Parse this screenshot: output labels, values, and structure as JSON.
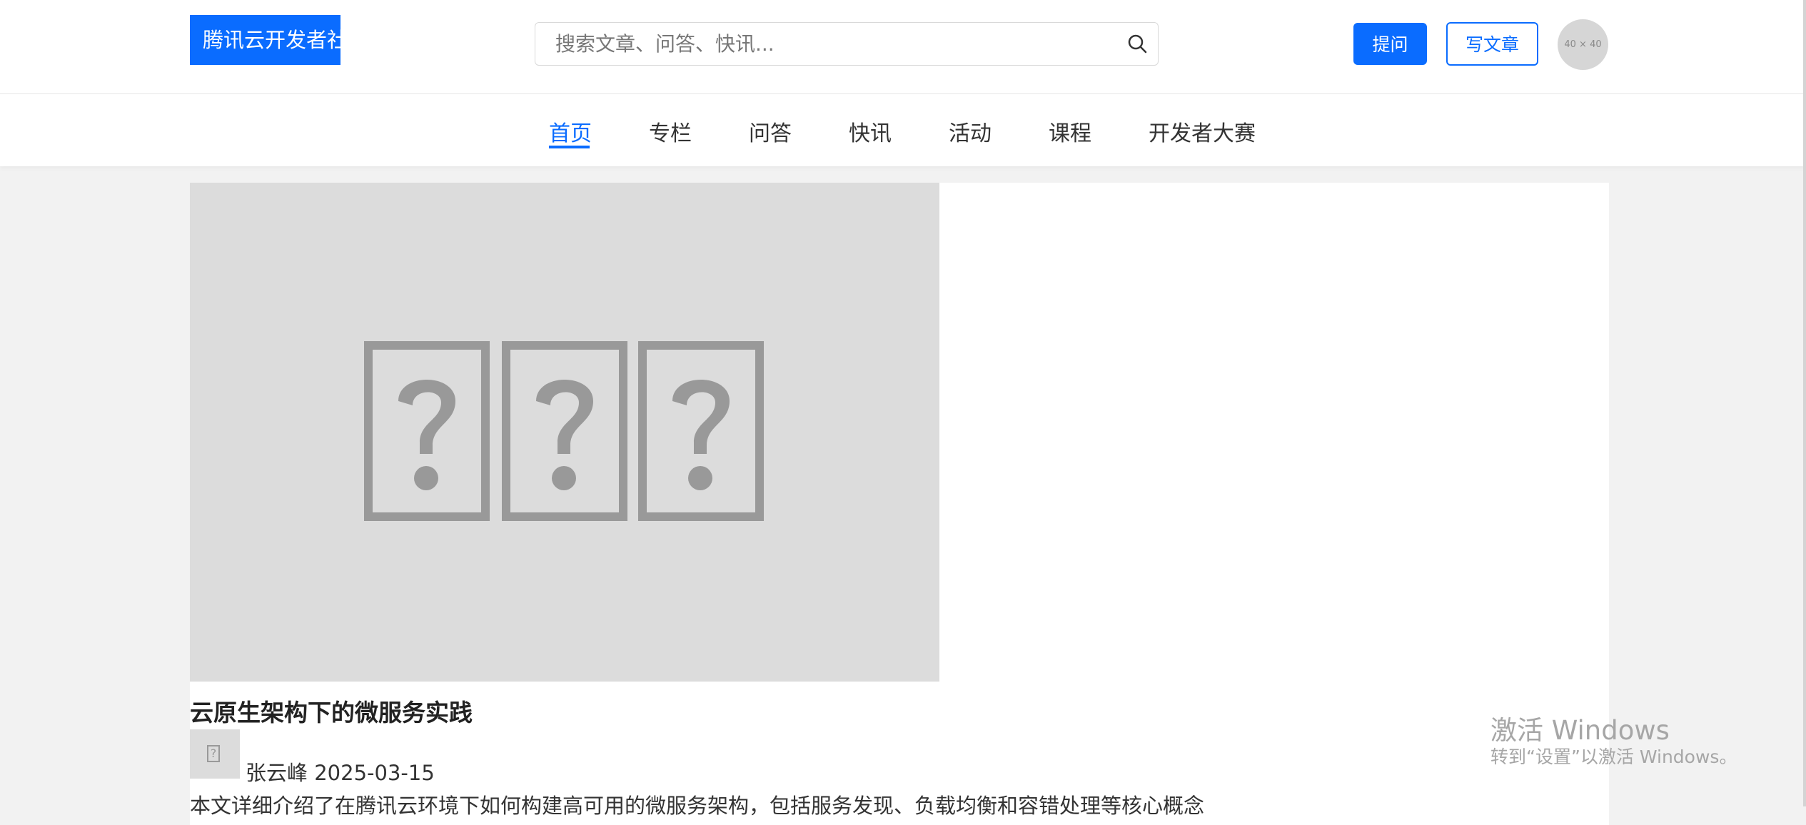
{
  "header": {
    "logo_text": "腾讯云开发者社",
    "search": {
      "placeholder": "搜索文章、问答、快讯...",
      "value": ""
    },
    "ask_button": "提问",
    "write_button": "写文章",
    "avatar_placeholder": "40 × 40"
  },
  "nav": {
    "items": [
      {
        "label": "首页",
        "active": true
      },
      {
        "label": "专栏"
      },
      {
        "label": "问答"
      },
      {
        "label": "快讯"
      },
      {
        "label": "活动"
      },
      {
        "label": "课程"
      },
      {
        "label": "开发者大赛"
      }
    ]
  },
  "article": {
    "title": "云原生架构下的微服务实践",
    "author": "张云峰",
    "date": "2025-03-15",
    "summary": "本文详细介绍了在腾讯云环境下如何构建高可用的微服务架构，包括服务发现、负载均衡和容错处理等核心概念"
  },
  "watermark": {
    "title": "激活 Windows",
    "subtitle": "转到“设置”以激活 Windows。"
  },
  "colors": {
    "accent": "#0a6cff",
    "page_bg": "#f2f2f2",
    "placeholder_bg": "#dcdcdc"
  }
}
